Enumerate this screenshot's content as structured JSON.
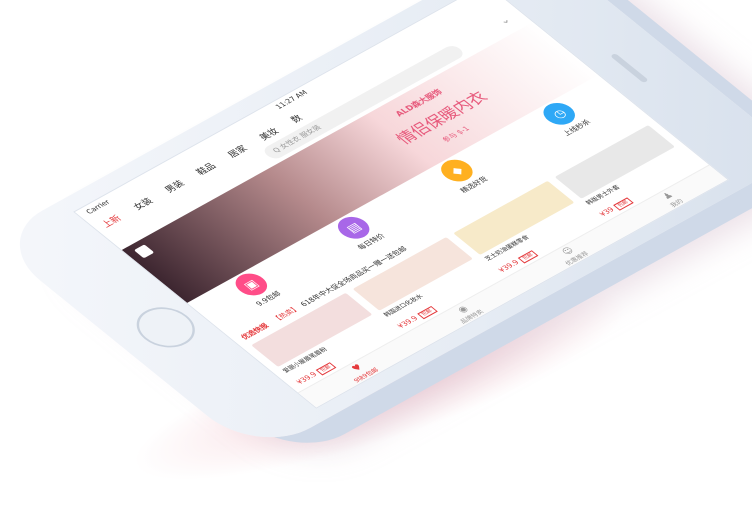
{
  "status": {
    "carrier": "Carrier",
    "time": "11:27 AM"
  },
  "top_nav": {
    "tabs": [
      "上新",
      "女装",
      "男装",
      "鞋品",
      "居家",
      "美妆",
      "数"
    ]
  },
  "search": {
    "placeholder": "Q 女性衣 服女装"
  },
  "banner": {
    "brand": "ALD森大服饰",
    "slogan": "情侣保暖内衣",
    "sub": "参与 $-1"
  },
  "icon_row": [
    {
      "label": "9.9包邮",
      "icon": "bag-icon",
      "color": "#ff4d88"
    },
    {
      "label": "每日特价",
      "icon": "gift-icon",
      "color": "#a867e8"
    },
    {
      "label": "精选好货",
      "icon": "diamond-icon",
      "color": "#ffb020"
    },
    {
      "label": "上线秒杀",
      "icon": "clock-icon",
      "color": "#2ea8f6"
    }
  ],
  "headline": {
    "logo": "优选快报",
    "tag": "【热卖】",
    "text": "618年中大促全场商品买一赠一送包邮"
  },
  "section_title": "热卖新品",
  "products": [
    {
      "name": "爱丽小屋眉笔眉粉",
      "price": "¥39.9",
      "badge": "包邮",
      "color": "#f3dede"
    },
    {
      "name": "韩国进口化妆水",
      "price": "¥39.9",
      "badge": "包邮",
      "color": "#f6e4dc"
    },
    {
      "name": "芝士奶油蛋糕零食",
      "price": "¥39.9",
      "badge": "包邮",
      "color": "#f7eac9"
    },
    {
      "name": "韩版男士外套",
      "price": "¥39",
      "badge": "包邮",
      "color": "#e8e8e8"
    }
  ],
  "bottom_bar": [
    {
      "label": "9块9包邮",
      "icon": "heart-icon",
      "active": true
    },
    {
      "label": "品牌特卖",
      "icon": "tag-icon",
      "active": false
    },
    {
      "label": "优惠推荐",
      "icon": "smile-icon",
      "active": false
    },
    {
      "label": "我的",
      "icon": "person-icon",
      "active": false
    }
  ]
}
